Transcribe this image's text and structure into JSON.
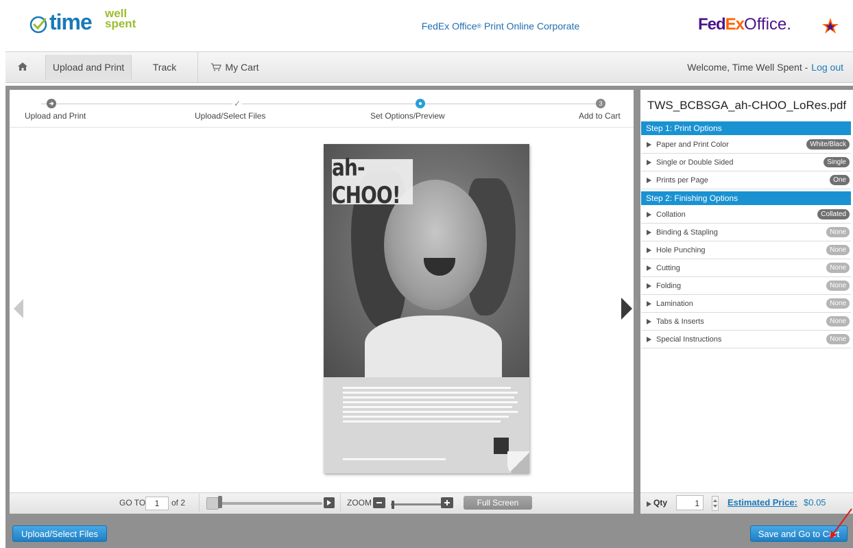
{
  "header": {
    "logo_time": "time",
    "logo_well": "well",
    "logo_spent": "spent",
    "site_title": "FedEx Office",
    "site_title_reg": "®",
    "site_title_rest": " Print Online Corporate",
    "brand_fe": "Fed",
    "brand_ex": "Ex",
    "brand_office": "Office."
  },
  "nav": {
    "home_icon": "home-icon",
    "tabs": [
      {
        "label": "Upload and Print"
      },
      {
        "label": "Track"
      },
      {
        "label": "My Cart"
      }
    ],
    "welcome": "Welcome, Time Well Spent -",
    "logout": "Log out"
  },
  "steps": [
    {
      "label": "Upload and Print"
    },
    {
      "label": "Upload/Select Files",
      "mark": "✓"
    },
    {
      "label": "Set Options/Preview"
    },
    {
      "label": "Add to Cart",
      "mark": "3"
    }
  ],
  "preview": {
    "headline": "ah-CHOO!"
  },
  "viewer_toolbar": {
    "goto_label": "GO TO",
    "page_value": "1",
    "of_label": "of 2",
    "zoom_label": "ZOOM",
    "fullscreen_label": "Full Screen"
  },
  "panel": {
    "filename": "TWS_BCBSGA_ah-CHOO_LoRes.pdf",
    "step1_header": "Step 1: Print Options",
    "step1_options": [
      {
        "label": "Paper and Print Color",
        "value": "White/Black"
      },
      {
        "label": "Single or Double Sided",
        "value": "Single"
      },
      {
        "label": "Prints per Page",
        "value": "One"
      }
    ],
    "step2_header": "Step 2: Finishing Options",
    "step2_options": [
      {
        "label": "Collation",
        "value": "Collated"
      },
      {
        "label": "Binding & Stapling",
        "value": "None"
      },
      {
        "label": "Hole Punching",
        "value": "None"
      },
      {
        "label": "Cutting",
        "value": "None"
      },
      {
        "label": "Folding",
        "value": "None"
      },
      {
        "label": "Lamination",
        "value": "None"
      },
      {
        "label": "Tabs & Inserts",
        "value": "None"
      },
      {
        "label": "Special Instructions",
        "value": "None"
      }
    ],
    "qty_label": "Qty",
    "qty_value": "1",
    "estimated_label": "Estimated Price:",
    "estimated_price": "$0.05"
  },
  "bottom": {
    "upload_button": "Upload/Select Files",
    "save_button": "Save and Go to Cart"
  },
  "colors": {
    "accent": "#1a92d2",
    "brand_purple": "#4d148c",
    "brand_orange": "#ff6200",
    "active_step": "#2a9fd8"
  }
}
